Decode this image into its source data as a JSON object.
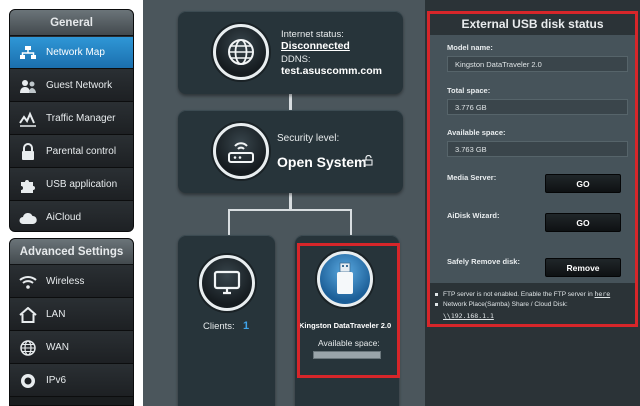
{
  "sidebar": {
    "general_header": "General",
    "general_items": [
      {
        "label": "Network Map",
        "icon": "network-map-icon",
        "active": true
      },
      {
        "label": "Guest Network",
        "icon": "guest-network-icon"
      },
      {
        "label": "Traffic Manager",
        "icon": "traffic-manager-icon"
      },
      {
        "label": "Parental control",
        "icon": "parental-control-icon"
      },
      {
        "label": "USB application",
        "icon": "usb-application-icon"
      },
      {
        "label": "AiCloud",
        "icon": "aicloud-icon"
      }
    ],
    "advanced_header": "Advanced Settings",
    "advanced_items": [
      {
        "label": "Wireless",
        "icon": "wireless-icon"
      },
      {
        "label": "LAN",
        "icon": "lan-icon"
      },
      {
        "label": "WAN",
        "icon": "wan-icon"
      },
      {
        "label": "IPv6",
        "icon": "ipv6-icon"
      }
    ]
  },
  "map": {
    "internet": {
      "status_label": "Internet status:",
      "status_value": "Disconnected",
      "ddns_label": "DDNS:",
      "ddns_value": "test.asuscomm.com"
    },
    "router": {
      "security_label": "Security level:",
      "security_value": "Open System"
    },
    "clients": {
      "label": "Clients:",
      "count": "1"
    },
    "usb": {
      "device_name": "Kingston DataTraveler 2.0",
      "available_label": "Available space:"
    }
  },
  "panel": {
    "title": "External USB disk status",
    "model_label": "Model name:",
    "model_value": "Kingston DataTraveler 2.0",
    "total_label": "Total space:",
    "total_value": "3.776 GB",
    "available_label": "Available space:",
    "available_value": "3.763 GB",
    "media_label": "Media Server:",
    "media_button": "GO",
    "aidisk_label": "AiDisk Wizard:",
    "aidisk_button": "GO",
    "remove_label": "Safely Remove disk:",
    "remove_button": "Remove",
    "note1_text": "FTP server is not enabled. Enable the FTP server in",
    "note1_link": "here",
    "note2_text": "Network Place(Samba) Share / Cloud Disk:",
    "note2_link": "\\\\192.168.1.1"
  },
  "colors": {
    "active_blue": "#2f97d6",
    "highlight_red": "#d7262a",
    "accent_blue": "#3fa4ea"
  }
}
